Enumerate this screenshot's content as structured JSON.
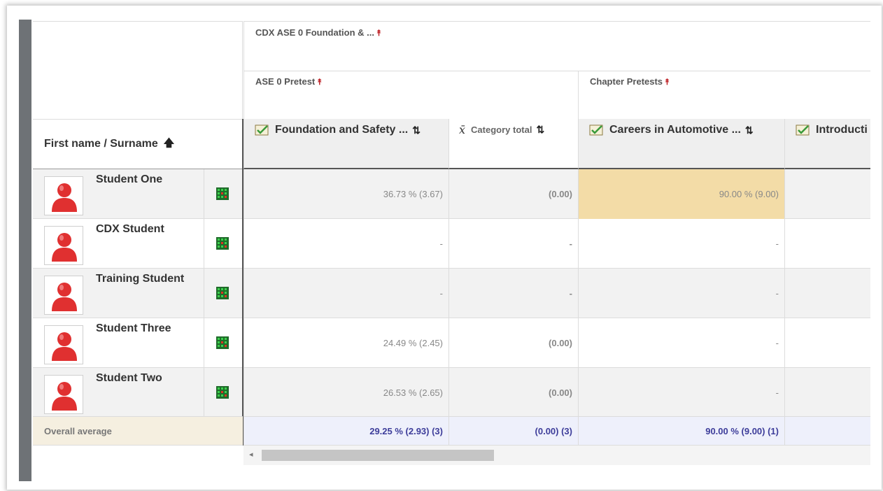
{
  "header": {
    "name_column_label": "First name / Surname",
    "category_top": "CDX ASE 0 Foundation & ...",
    "category_a": "ASE 0 Pretest",
    "category_b": "Chapter Pretests"
  },
  "columns": [
    {
      "label": "Foundation and Safety ..."
    },
    {
      "label": "Category total"
    },
    {
      "label": "Careers in Automotive ..."
    },
    {
      "label": "Introducti"
    }
  ],
  "students": [
    {
      "name": "Student One",
      "col1": "36.73 % (3.67)",
      "col2": "(0.00)",
      "col3": "90.00 % (9.00)",
      "col4": ""
    },
    {
      "name": "CDX Student",
      "col1": "-",
      "col2": "-",
      "col3": "-",
      "col4": ""
    },
    {
      "name": "Training Student",
      "col1": "-",
      "col2": "-",
      "col3": "-",
      "col4": ""
    },
    {
      "name": "Student Three",
      "col1": "24.49 % (2.45)",
      "col2": "(0.00)",
      "col3": "-",
      "col4": ""
    },
    {
      "name": "Student Two",
      "col1": "26.53 % (2.65)",
      "col2": "(0.00)",
      "col3": "-",
      "col4": ""
    }
  ],
  "average": {
    "label": "Overall average",
    "col1": "29.25 % (2.93) (3)",
    "col2": "(0.00) (3)",
    "col3": "90.00 % (9.00) (1)"
  },
  "colors": {
    "highlight": "#f3dca7",
    "average_text": "#3d3d9a",
    "collapse_icon": "#c0282d",
    "avatar": "#e03030"
  },
  "icons": {
    "sort_asc": "arrow-up-icon",
    "sort": "sort-icon",
    "collapse": "collapse-icon",
    "quiz": "quiz-icon",
    "mean": "mean-icon",
    "report": "grade-report-icon",
    "avatar": "user-avatar-icon"
  }
}
